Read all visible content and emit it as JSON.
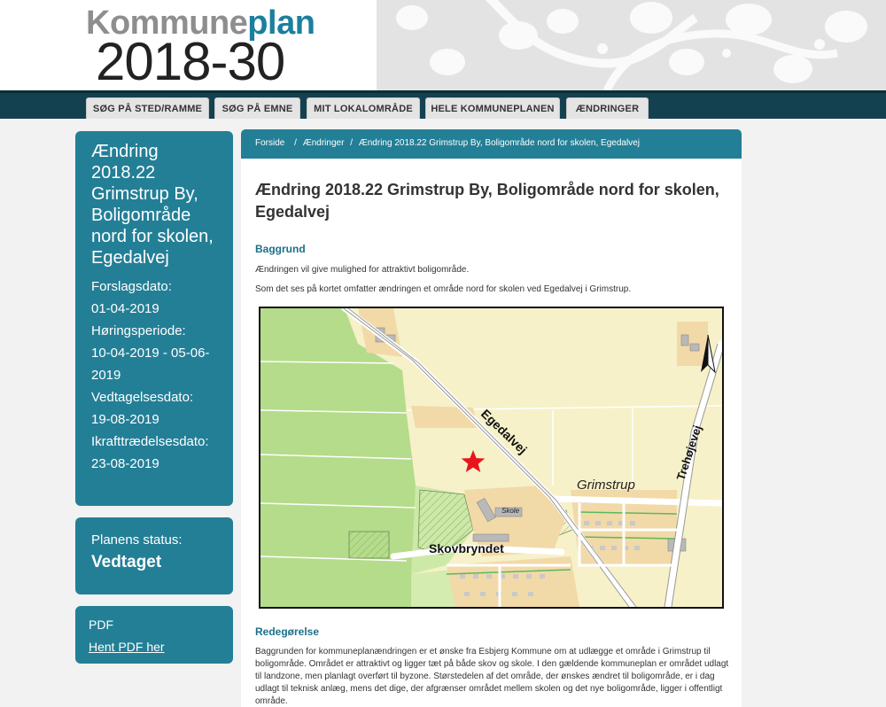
{
  "header": {
    "brand_part1": "Kommune",
    "brand_part2": "plan",
    "brand_year": "2018-30"
  },
  "nav": {
    "tabs": [
      {
        "label": "SØG PÅ STED/RAMME"
      },
      {
        "label": "SØG PÅ EMNE"
      },
      {
        "label": "MIT LOKALOMRÅDE"
      },
      {
        "label": "HELE KOMMUNEPLANEN"
      },
      {
        "label": "ÆNDRINGER"
      }
    ]
  },
  "sidebar": {
    "title": "Ændring 2018.22 Grimstrup By, Boligområde nord for skolen, Egedalvej",
    "proposal_label": "Forslagsdato:",
    "proposal_date": "01-04-2019",
    "hearing_label": "Høringsperiode:",
    "hearing_period": "10-04-2019 - 05-06-2019",
    "adopted_label": "Vedtagelsesdato:",
    "adopted_date": "19-08-2019",
    "effective_label": "Ikrafttrædelsesdato:",
    "effective_date": "23-08-2019",
    "status_label": "Planens status:",
    "status_value": "Vedtaget",
    "pdf_label": "PDF",
    "pdf_link": "Hent PDF her"
  },
  "breadcrumb": {
    "home": "Forside",
    "sep1": "/",
    "changes": "Ændringer",
    "sep2": "/",
    "current": "Ændring 2018.22 Grimstrup By, Boligområde nord for skolen, Egedalvej"
  },
  "content": {
    "title": "Ændring 2018.22 Grimstrup By, Boligområde nord for skolen, Egedalvej",
    "section1_heading": "Baggrund",
    "section1_p1": "Ændringen vil give mulighed for attraktivt boligområde.",
    "section1_p2": "Som det ses på kortet omfatter ændringen et område nord for skolen ved Egedalvej i Grimstrup.",
    "section2_heading": "Redegørelse",
    "section2_p1": "Baggrunden for kommuneplanændringen er et ønske fra Esbjerg Kommune om at udlægge et område i Grimstrup til boligområde. Området er attraktivt og ligger tæt på både skov og skole. I den gældende kommuneplan er området udlagt til landzone, men planlagt overført til byzone. Størstedelen af det område, der ønskes ændret til boligområde, er i dag udlagt til teknisk anlæg, mens det dige, der afgrænser området mellem skolen og det nye boligområde, ligger i offentligt område."
  },
  "map": {
    "label_egedalvej": "Egedalvej",
    "label_trehojevej": "Trehøjevej",
    "label_grimstrup": "Grimstrup",
    "label_skole": "Skole",
    "label_skovbryndet": "Skovbryndet",
    "marker_color": "#e8141c",
    "forest_color": "#b4dc8a",
    "field_color": "#f6f1c8",
    "school_color": "#f2d9a8"
  }
}
